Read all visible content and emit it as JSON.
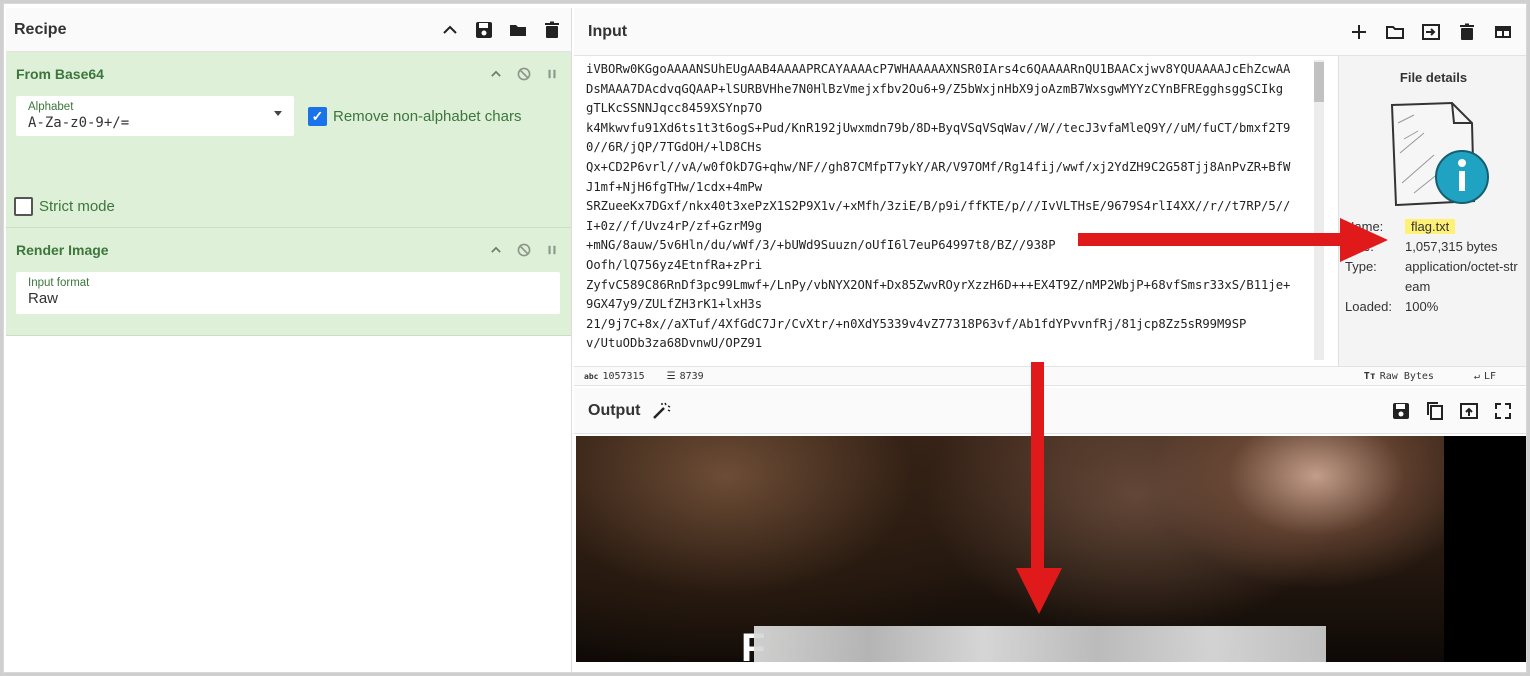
{
  "recipe": {
    "title": "Recipe",
    "ops": [
      {
        "title": "From Base64",
        "alphabet_label": "Alphabet",
        "alphabet_value": "A-Za-z0-9+/=",
        "remove_label": "Remove non-alphabet chars",
        "strict_label": "Strict mode"
      },
      {
        "title": "Render Image",
        "format_label": "Input format",
        "format_value": "Raw"
      }
    ]
  },
  "input": {
    "title": "Input",
    "lines": [
      "iVBORw0KGgoAAAANSUhEUgAAB4AAAAPRCAYAAAAcP7WHAAAAAXNSR0IArs4c6QAAAARnQU1BAACxjwv8YQUAAAAJcEhZcwAA",
      "DsMAAA7DAcdvqGQAAP+lSURBVHhe7N0HlBzVmejxfbv2Ou6+9/Z5bWxjnHbX9joAzmB7WxsgwMYYzCYnBFREgghsggSCIkg",
      "gTLKcSSNNJqcc8459XSYnp7O",
      "k4Mkwvfu91Xd6ts1t3t6ogS+Pud/KnR192jUwxmdn79b/8D+ByqVSqVSqWav//W//tecJ3vfaMleQ9Y//uM/fuCT/bmxf2T9",
      "0//6R/jQP/7TGdOH/+lD8CHs",
      "Qx+CD2P6vrl//vA/w0fOkD7G+qhw/NF//gh87CMfpT7ykY/AR/V97OMf/Rg14fij/wwf/xj2YdZH9C2G58Tjj8AnPvZR+BfW",
      "J1mf+NjH6fgTHw/1cdx+4mPw",
      "SRZueeKx7DGxf/nkx40t3xePzX1S2P9X1v/+xMfh/3ziE/B/p9i/ffKTE/p///IvVLTHsE/9679S4rlI4XX//r//t7RP/5//",
      "I+0z//f/Uvz4rP/zf+GzrM9g",
      "+mNG/8auw/5v6Hln/du/wWf/3/+bUWd9Suuzn/oUfI6l7euP64997t8/BZ//938P",
      "Oofh/lQ756yz4EtnfRa+zPri",
      "ZyfvC589C86RnDf3pc99Lmwf+/LnPy/vbNYX2ONf+Dx85ZwvROyrXzzH6D+++EX4T9Z/nMP2WbjP+68vfSmsr33xS/B11je+",
      "9GX47y9/ZULfZH3rK1+lxH3s",
      "21/9j7C+8x//aXTuf/4XfGdC7Jr/CvXtr/+n0XdY5339v4vZ77318P63vf/Ab1fdYPvvnfRj/81jcp8Zz5sR99M9SP",
      "v/UtuODb3za68DvnwU/OPZ91"
    ],
    "file_details_title": "File details",
    "file": {
      "name_key": "Name:",
      "name": "flag.txt",
      "size_key": "Size:",
      "size": "1,057,315 bytes",
      "type_key": "Type:",
      "type": "application/octet-stream",
      "loaded_key": "Loaded:",
      "loaded": "100%"
    },
    "status": {
      "chars_icon": "abc",
      "chars": "1057315",
      "lines": "8739",
      "encoding": "Raw Bytes",
      "eol": "LF"
    }
  },
  "output": {
    "title": "Output",
    "caption_letter": "F"
  },
  "colors": {
    "op_bg": "#dff0d8",
    "op_text": "#3c763d",
    "arrow": "#e01a1a",
    "highlight": "#fff176"
  }
}
